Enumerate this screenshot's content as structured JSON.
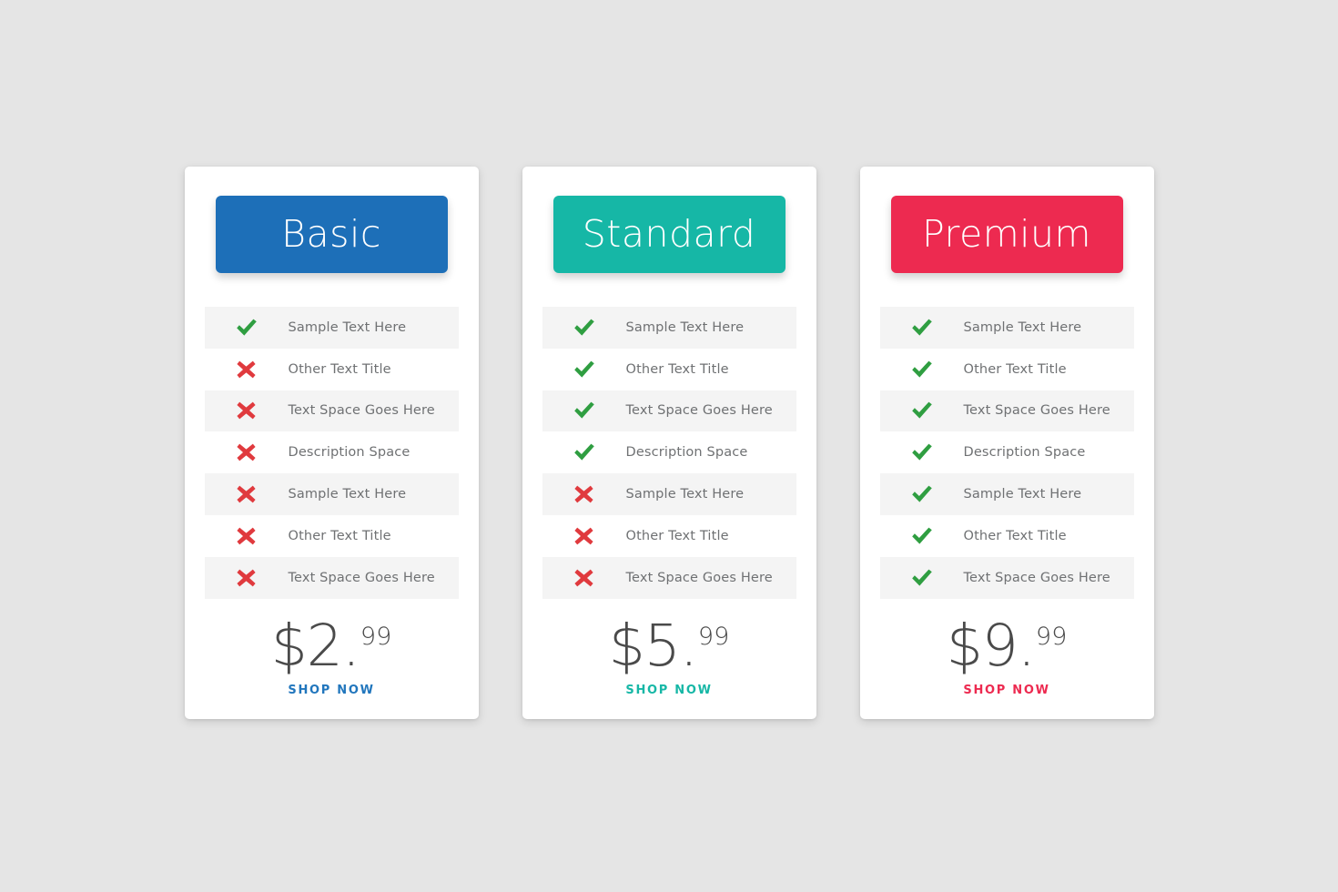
{
  "page": {
    "background_color": "#e5e5e5"
  },
  "plans": [
    {
      "name": "Basic",
      "accent_color": "#1d6fb8",
      "cta_color": "#2176bd",
      "price_currency": "$",
      "price_whole": "2",
      "price_separator": ".",
      "price_cents": "99",
      "price_display": "$2.99",
      "cta_label": "SHOP NOW",
      "features": [
        {
          "label": "Sample Text Here",
          "included": true
        },
        {
          "label": "Other Text Title",
          "included": false
        },
        {
          "label": "Text Space Goes Here",
          "included": false
        },
        {
          "label": "Description Space",
          "included": false
        },
        {
          "label": "Sample Text Here",
          "included": false
        },
        {
          "label": "Other Text Title",
          "included": false
        },
        {
          "label": "Text Space Goes Here",
          "included": false
        }
      ]
    },
    {
      "name": "Standard",
      "accent_color": "#16b7a6",
      "cta_color": "#16b7a6",
      "price_currency": "$",
      "price_whole": "5",
      "price_separator": ".",
      "price_cents": "99",
      "price_display": "$5.99",
      "cta_label": "SHOP NOW",
      "features": [
        {
          "label": "Sample Text Here",
          "included": true
        },
        {
          "label": "Other Text Title",
          "included": true
        },
        {
          "label": "Text Space Goes Here",
          "included": true
        },
        {
          "label": "Description Space",
          "included": true
        },
        {
          "label": "Sample Text Here",
          "included": false
        },
        {
          "label": "Other Text Title",
          "included": false
        },
        {
          "label": "Text Space Goes Here",
          "included": false
        }
      ]
    },
    {
      "name": "Premium",
      "accent_color": "#ed2a50",
      "cta_color": "#ed2a50",
      "price_currency": "$",
      "price_whole": "9",
      "price_separator": ".",
      "price_cents": "99",
      "price_display": "$9.99",
      "cta_label": "SHOP NOW",
      "features": [
        {
          "label": "Sample Text Here",
          "included": true
        },
        {
          "label": "Other Text Title",
          "included": true
        },
        {
          "label": "Text Space Goes Here",
          "included": true
        },
        {
          "label": "Description Space",
          "included": true
        },
        {
          "label": "Sample Text Here",
          "included": true
        },
        {
          "label": "Other Text Title",
          "included": true
        },
        {
          "label": "Text Space Goes Here",
          "included": true
        }
      ]
    }
  ],
  "icons": {
    "included": {
      "name": "check-icon",
      "color": "#2f9e41"
    },
    "excluded": {
      "name": "cross-icon",
      "color": "#e03a3e"
    }
  }
}
